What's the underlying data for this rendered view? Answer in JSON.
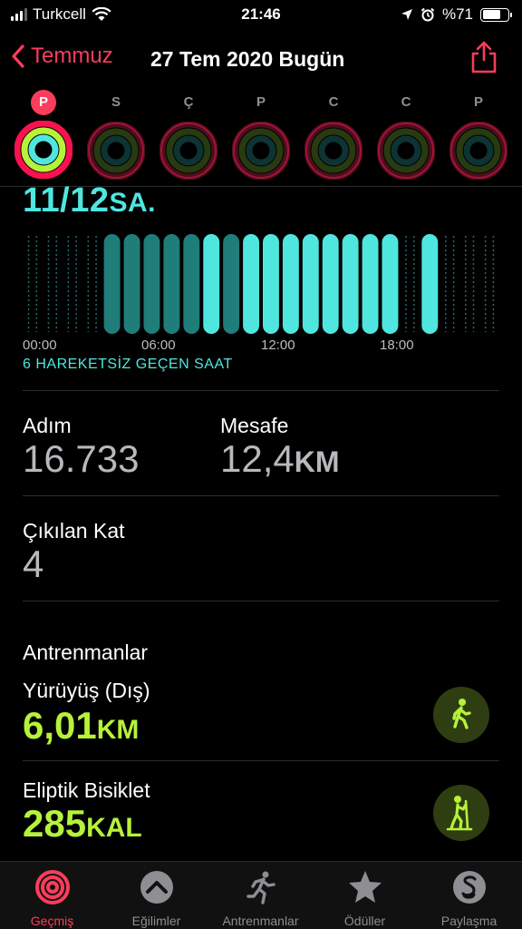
{
  "status_bar": {
    "carrier": "Turkcell",
    "time": "21:46",
    "battery": "%71",
    "battery_level": 0.71
  },
  "nav": {
    "back_label": "Temmuz",
    "title": "27 Tem 2020 Bugün"
  },
  "week": {
    "days": [
      {
        "letter": "P",
        "today": true
      },
      {
        "letter": "S",
        "today": false
      },
      {
        "letter": "Ç",
        "today": false
      },
      {
        "letter": "P",
        "today": false
      },
      {
        "letter": "C",
        "today": false
      },
      {
        "letter": "C",
        "today": false
      },
      {
        "letter": "P",
        "today": false
      }
    ]
  },
  "stand": {
    "value": "11/12",
    "unit": "SA.",
    "inactive_text": "6 HAREKETSİZ GEÇEN SAAT",
    "time_labels": [
      "00:00",
      "06:00",
      "12:00",
      "18:00"
    ],
    "hours_active": [
      0,
      0,
      0,
      0,
      1,
      1,
      1,
      1,
      1,
      1,
      1,
      1,
      1,
      1,
      1,
      1,
      1,
      1,
      1,
      0,
      1,
      0,
      0,
      0
    ],
    "hours_bright": [
      0,
      0,
      0,
      0,
      0,
      0,
      0,
      0,
      0,
      1,
      0,
      1,
      1,
      1,
      1,
      1,
      1,
      1,
      1,
      0,
      1,
      0,
      0,
      0
    ]
  },
  "stats": {
    "steps_label": "Adım",
    "steps_value": "16.733",
    "distance_label": "Mesafe",
    "distance_value": "12,4",
    "distance_unit": "KM",
    "floors_label": "Çıkılan Kat",
    "floors_value": "4"
  },
  "workouts": {
    "title": "Antrenmanlar",
    "items": [
      {
        "name": "Yürüyüş (Dış)",
        "value": "6,01",
        "unit": "KM",
        "icon": "walking-icon"
      },
      {
        "name": "Eliptik Bisiklet",
        "value": "285",
        "unit": "KAL",
        "icon": "elliptical-icon"
      }
    ]
  },
  "tabbar": {
    "tabs": [
      {
        "label": "Geçmiş",
        "icon": "rings-icon",
        "active": true
      },
      {
        "label": "Eğilimler",
        "icon": "trends-icon",
        "active": false
      },
      {
        "label": "Antrenmanlar",
        "icon": "runner-icon",
        "active": false
      },
      {
        "label": "Ödüller",
        "icon": "star-icon",
        "active": false
      },
      {
        "label": "Paylaşma",
        "icon": "sharing-icon",
        "active": false
      }
    ]
  },
  "colors": {
    "accent": "#fa3d5c",
    "stand": "#4fe6e0",
    "exercise": "#b6f23a",
    "move": "#fa114f"
  }
}
